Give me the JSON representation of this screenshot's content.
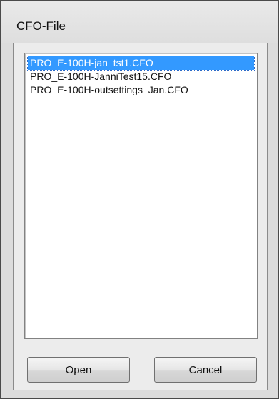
{
  "window": {
    "title": "CFO-File"
  },
  "file_list": {
    "items": [
      {
        "label": "PRO_E-100H-jan_tst1.CFO",
        "selected": true
      },
      {
        "label": "PRO_E-100H-JanniTest15.CFO",
        "selected": false
      },
      {
        "label": "PRO_E-100H-outsettings_Jan.CFO",
        "selected": false
      }
    ]
  },
  "buttons": {
    "open_label": "Open",
    "cancel_label": "Cancel"
  },
  "colors": {
    "selection_bg": "#3399ff",
    "selection_text": "#ffffff"
  }
}
